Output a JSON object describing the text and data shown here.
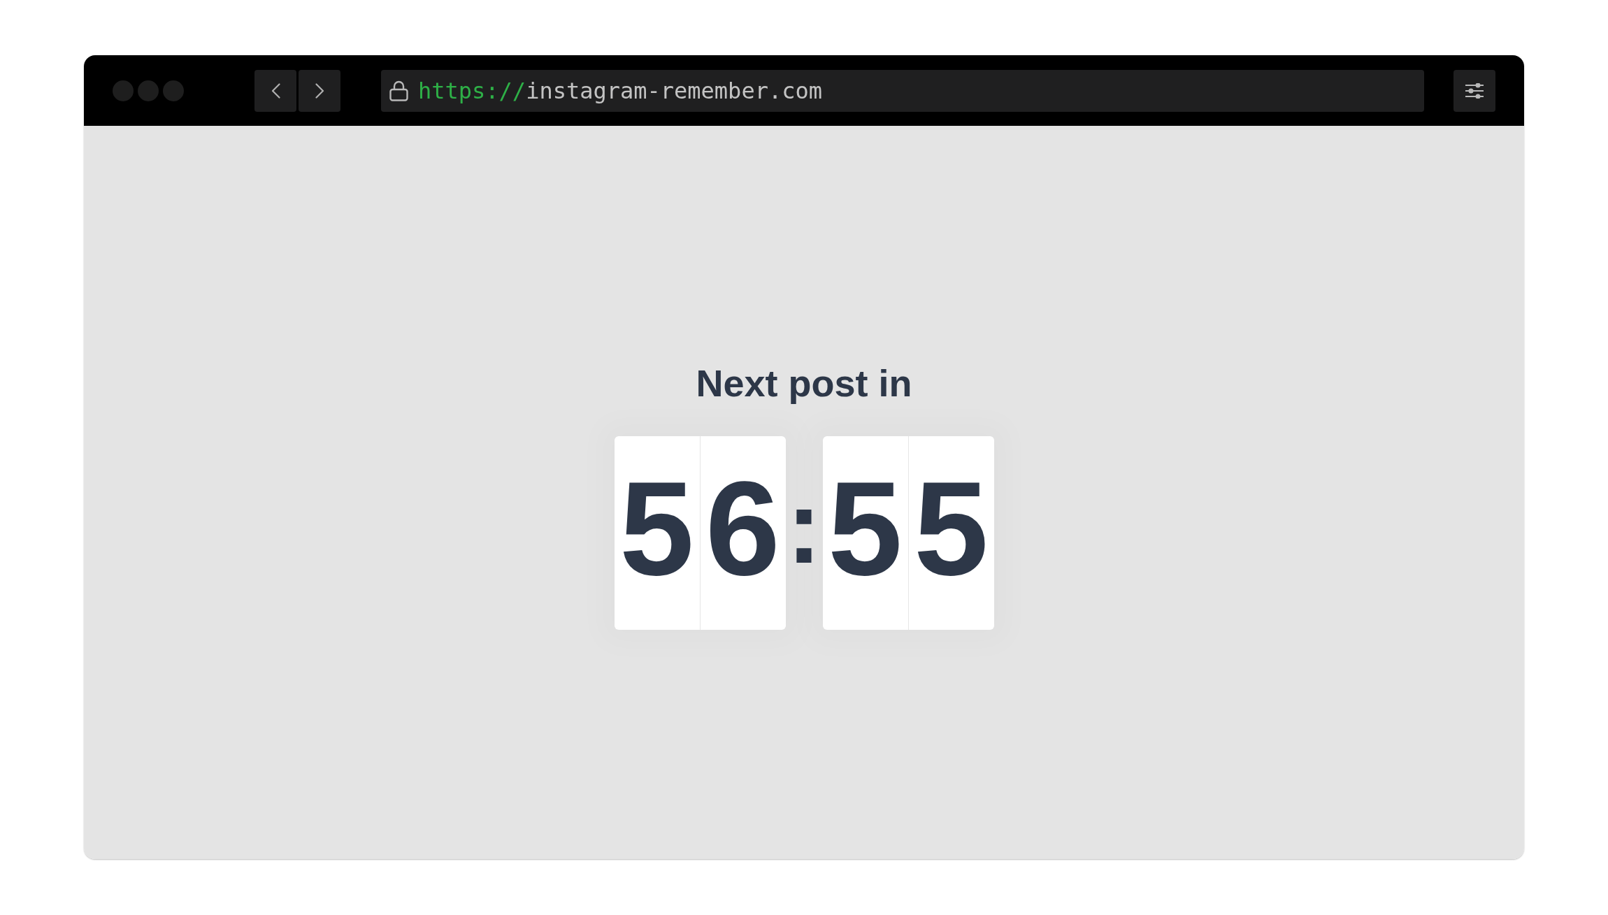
{
  "browser": {
    "address_bar": {
      "scheme": "https://",
      "host": "instagram-remember.com"
    }
  },
  "countdown": {
    "title": "Next post in",
    "groups": [
      {
        "digits": [
          "5",
          "6"
        ]
      },
      {
        "digits": [
          "5",
          "5"
        ]
      }
    ],
    "separator": ":"
  }
}
